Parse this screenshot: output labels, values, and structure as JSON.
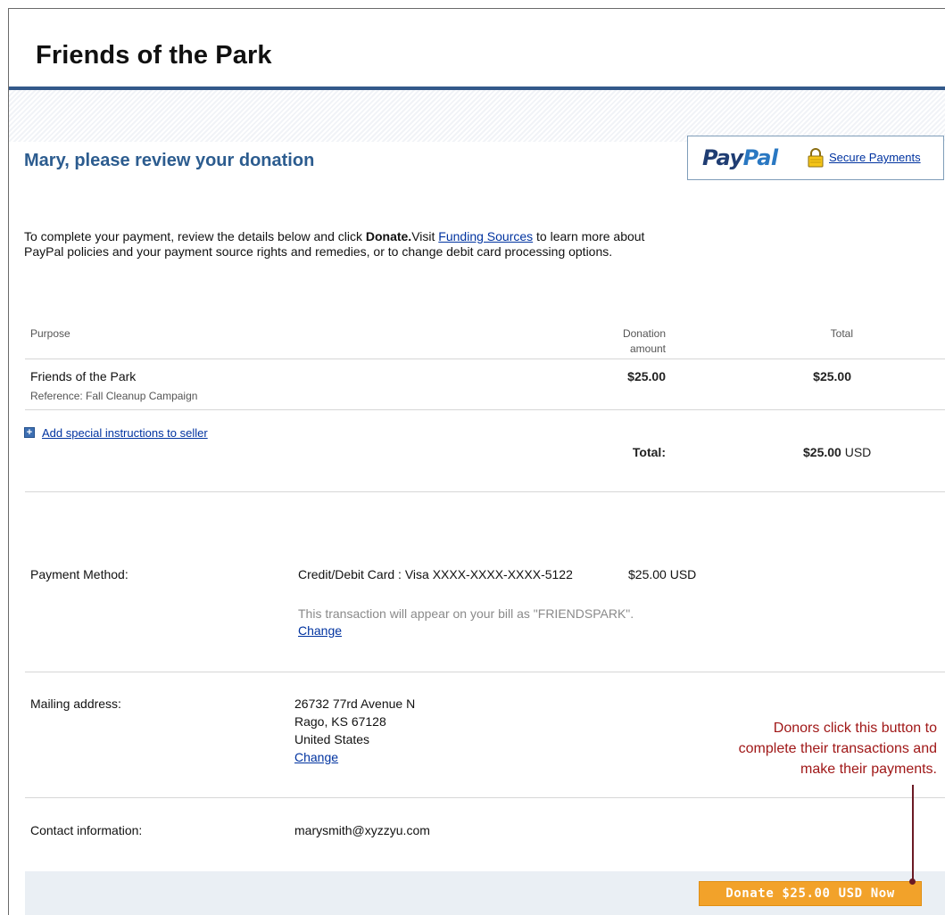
{
  "header": {
    "site_title": "Friends of the Park"
  },
  "review": {
    "heading": "Mary, please review your donation"
  },
  "paypal_badge": {
    "logo_pay": "Pay",
    "logo_pal": "Pal",
    "secure_link": "Secure Payments",
    "icon": "lock-icon"
  },
  "intro": {
    "part1": "To complete your payment, review the details below and click ",
    "donate_word": "Donate.",
    "part2": "Visit ",
    "funding_link": "Funding Sources",
    "part3": " to learn more about PayPal policies and your payment source rights and remedies, or to change debit card processing options."
  },
  "table": {
    "col_purpose": "Purpose",
    "col_donation_line1": "Donation",
    "col_donation_line2": "amount",
    "col_total": "Total",
    "item": {
      "name": "Friends of the Park",
      "reference": "Reference: Fall Cleanup Campaign",
      "donation_amount": "$25.00",
      "total": "$25.00"
    },
    "add_instructions": "Add special instructions to seller",
    "total_label": "Total:",
    "total_amount": "$25.00",
    "total_currency": " USD"
  },
  "payment": {
    "label": "Payment Method:",
    "card": "Credit/Debit Card : Visa XXXX-XXXX-XXXX-5122",
    "amount": "$25.00 USD",
    "bill_note": "This transaction will appear on your bill as \"FRIENDSPARK\".",
    "change": "Change"
  },
  "mailing": {
    "label": "Mailing address:",
    "line1": "26732 77rd Avenue N",
    "line2": "Rago, KS 67128",
    "line3": "United States",
    "change": "Change"
  },
  "contact": {
    "label": "Contact information:",
    "email": "marysmith@xyzzyu.com"
  },
  "donate_button": {
    "label": "Donate $25.00 USD Now"
  },
  "callout": {
    "line1": "Donors click this button to",
    "line2": "complete their transactions and",
    "line3": "make their payments."
  },
  "colors": {
    "accent_blue": "#2c5c8f",
    "header_rule": "#33598a",
    "link": "#0033a0",
    "donate_orange": "#f2a22a",
    "callout_red": "#a01818"
  }
}
